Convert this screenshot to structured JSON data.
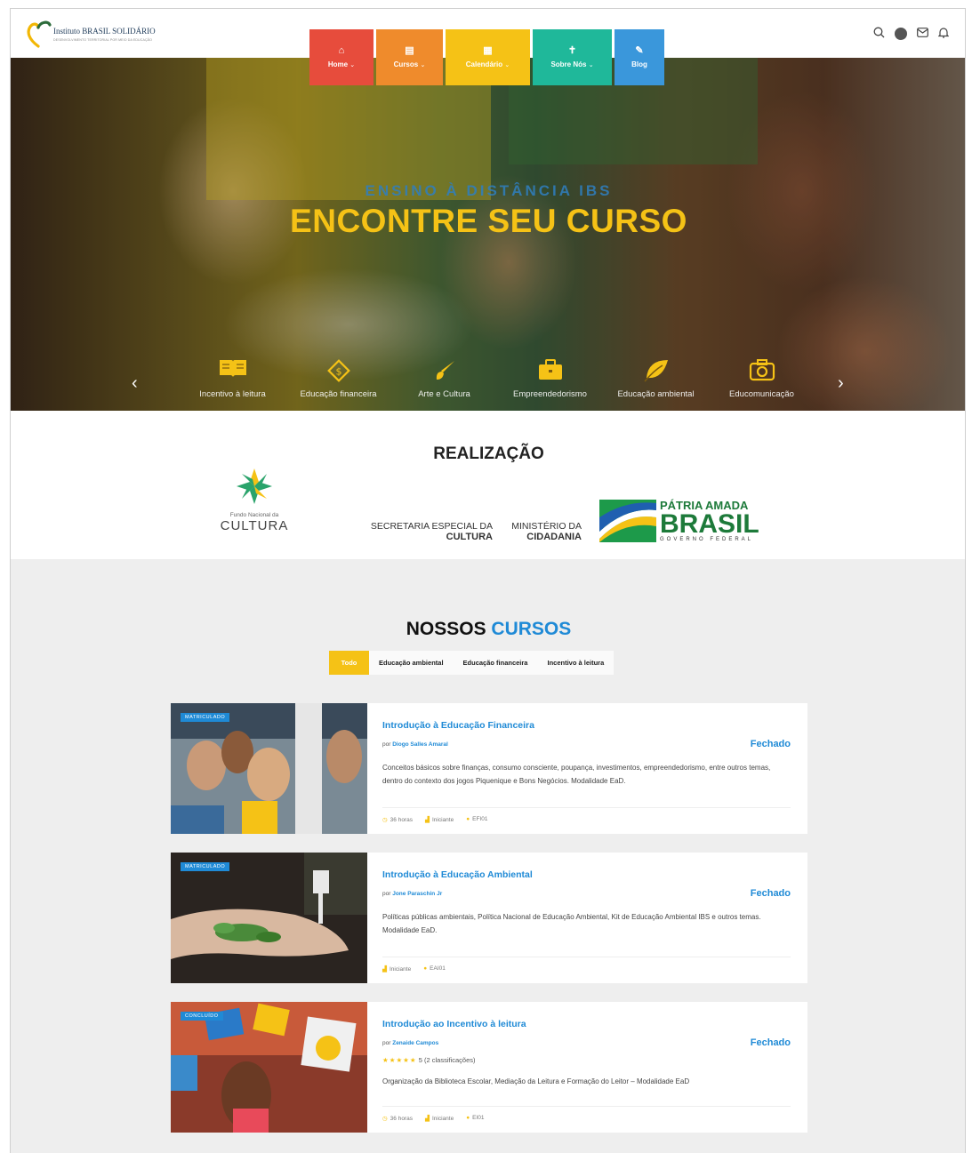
{
  "header": {
    "logo_name": "Instituto BRASIL SOLIDÁRIO",
    "logo_tagline": "DESENVOLVIMENTO TERRITORIAL POR MEIO DA EDUCAÇÃO",
    "menu": [
      {
        "label": "Home",
        "icon": "home-icon",
        "glyph": "⌂",
        "caret": "⌄",
        "color": "#e74c3c"
      },
      {
        "label": "Cursos",
        "icon": "book-icon",
        "glyph": "▤",
        "caret": "⌄",
        "color": "#ef8b2c"
      },
      {
        "label": "Calendário",
        "icon": "calendar-icon",
        "glyph": "▦",
        "caret": "⌄",
        "color": "#f5c216"
      },
      {
        "label": "Sobre Nós",
        "icon": "info-icon",
        "glyph": "✝",
        "caret": "⌄",
        "color": "#1fb89a"
      },
      {
        "label": "Blog",
        "icon": "edit-icon",
        "glyph": "✎",
        "caret": "",
        "color": "#3a97db"
      }
    ],
    "icons": [
      "search-icon",
      "avatar",
      "mail-icon",
      "bell-icon"
    ]
  },
  "hero": {
    "subtitle": "ENSINO À DISTÂNCIA IBS",
    "title": "ENCONTRE SEU CURSO",
    "arrow_left": "‹",
    "arrow_right": "›",
    "categories": [
      {
        "label": "Incentivo à leitura",
        "icon": "open-book-icon",
        "glyph": "📖"
      },
      {
        "label": "Educação financeira",
        "icon": "money-diamond-icon",
        "glyph": "◈"
      },
      {
        "label": "Arte e Cultura",
        "icon": "brush-icon",
        "glyph": "✐"
      },
      {
        "label": "Empreendedorismo",
        "icon": "briefcase-icon",
        "glyph": "💼"
      },
      {
        "label": "Educação ambiental",
        "icon": "leaf-icon",
        "glyph": "❦"
      },
      {
        "label": "Educomunicação",
        "icon": "camera-icon",
        "glyph": "◙"
      }
    ]
  },
  "realizacao": {
    "title": "REALIZAÇÃO",
    "fnc_small": "Fundo Nacional da",
    "fnc_big": "CULTURA",
    "secretaria_line1": "SECRETARIA ESPECIAL DA",
    "secretaria_line2": "CULTURA",
    "ministerio_line1": "MINISTÉRIO DA",
    "ministerio_line2": "CIDADANIA",
    "patria_line1": "PÁTRIA AMADA",
    "patria_line2": "BRASIL",
    "patria_line3": "GOVERNO FEDERAL"
  },
  "cursos": {
    "title_main": "NOSSOS",
    "title_accent": "CURSOS",
    "filters": [
      "Todo",
      "Educação ambiental",
      "Educação financeira",
      "Incentivo à leitura"
    ],
    "items": [
      {
        "badge": "MATRICULADO",
        "title": "Introdução à Educação Financeira",
        "author_prefix": "por",
        "author": "Diogo Salles Amaral",
        "status": "Fechado",
        "description": "Conceitos básicos sobre finanças, consumo consciente, poupança, investimentos, empreendedorismo, entre outros temas, dentro do contexto dos jogos Piquenique e Bons Negócios. Modalidade EaD.",
        "rating": "",
        "meta": [
          "36 horas",
          "Iniciante",
          "EFI01"
        ]
      },
      {
        "badge": "MATRICULADO",
        "title": "Introdução à Educação Ambiental",
        "author_prefix": "por",
        "author": "Jone Paraschin Jr",
        "status": "Fechado",
        "description": "Políticas públicas ambientais, Política Nacional de Educação Ambiental, Kit de Educação Ambiental IBS e outros temas. Modalidade EaD.",
        "rating": "",
        "meta": [
          "Iniciante",
          "EAI01"
        ]
      },
      {
        "badge": "CONCLUÍDO",
        "title": "Introdução ao Incentivo à leitura",
        "author_prefix": "por",
        "author": "Zenaide Campos",
        "status": "Fechado",
        "stars": "★★★★★",
        "rating": "5 (2 classificações)",
        "description": "Organização da Biblioteca Escolar, Mediação da Leitura e Formação do Leitor – Modalidade EaD",
        "meta": [
          "36 horas",
          "Iniciante",
          "EI01"
        ]
      }
    ]
  }
}
